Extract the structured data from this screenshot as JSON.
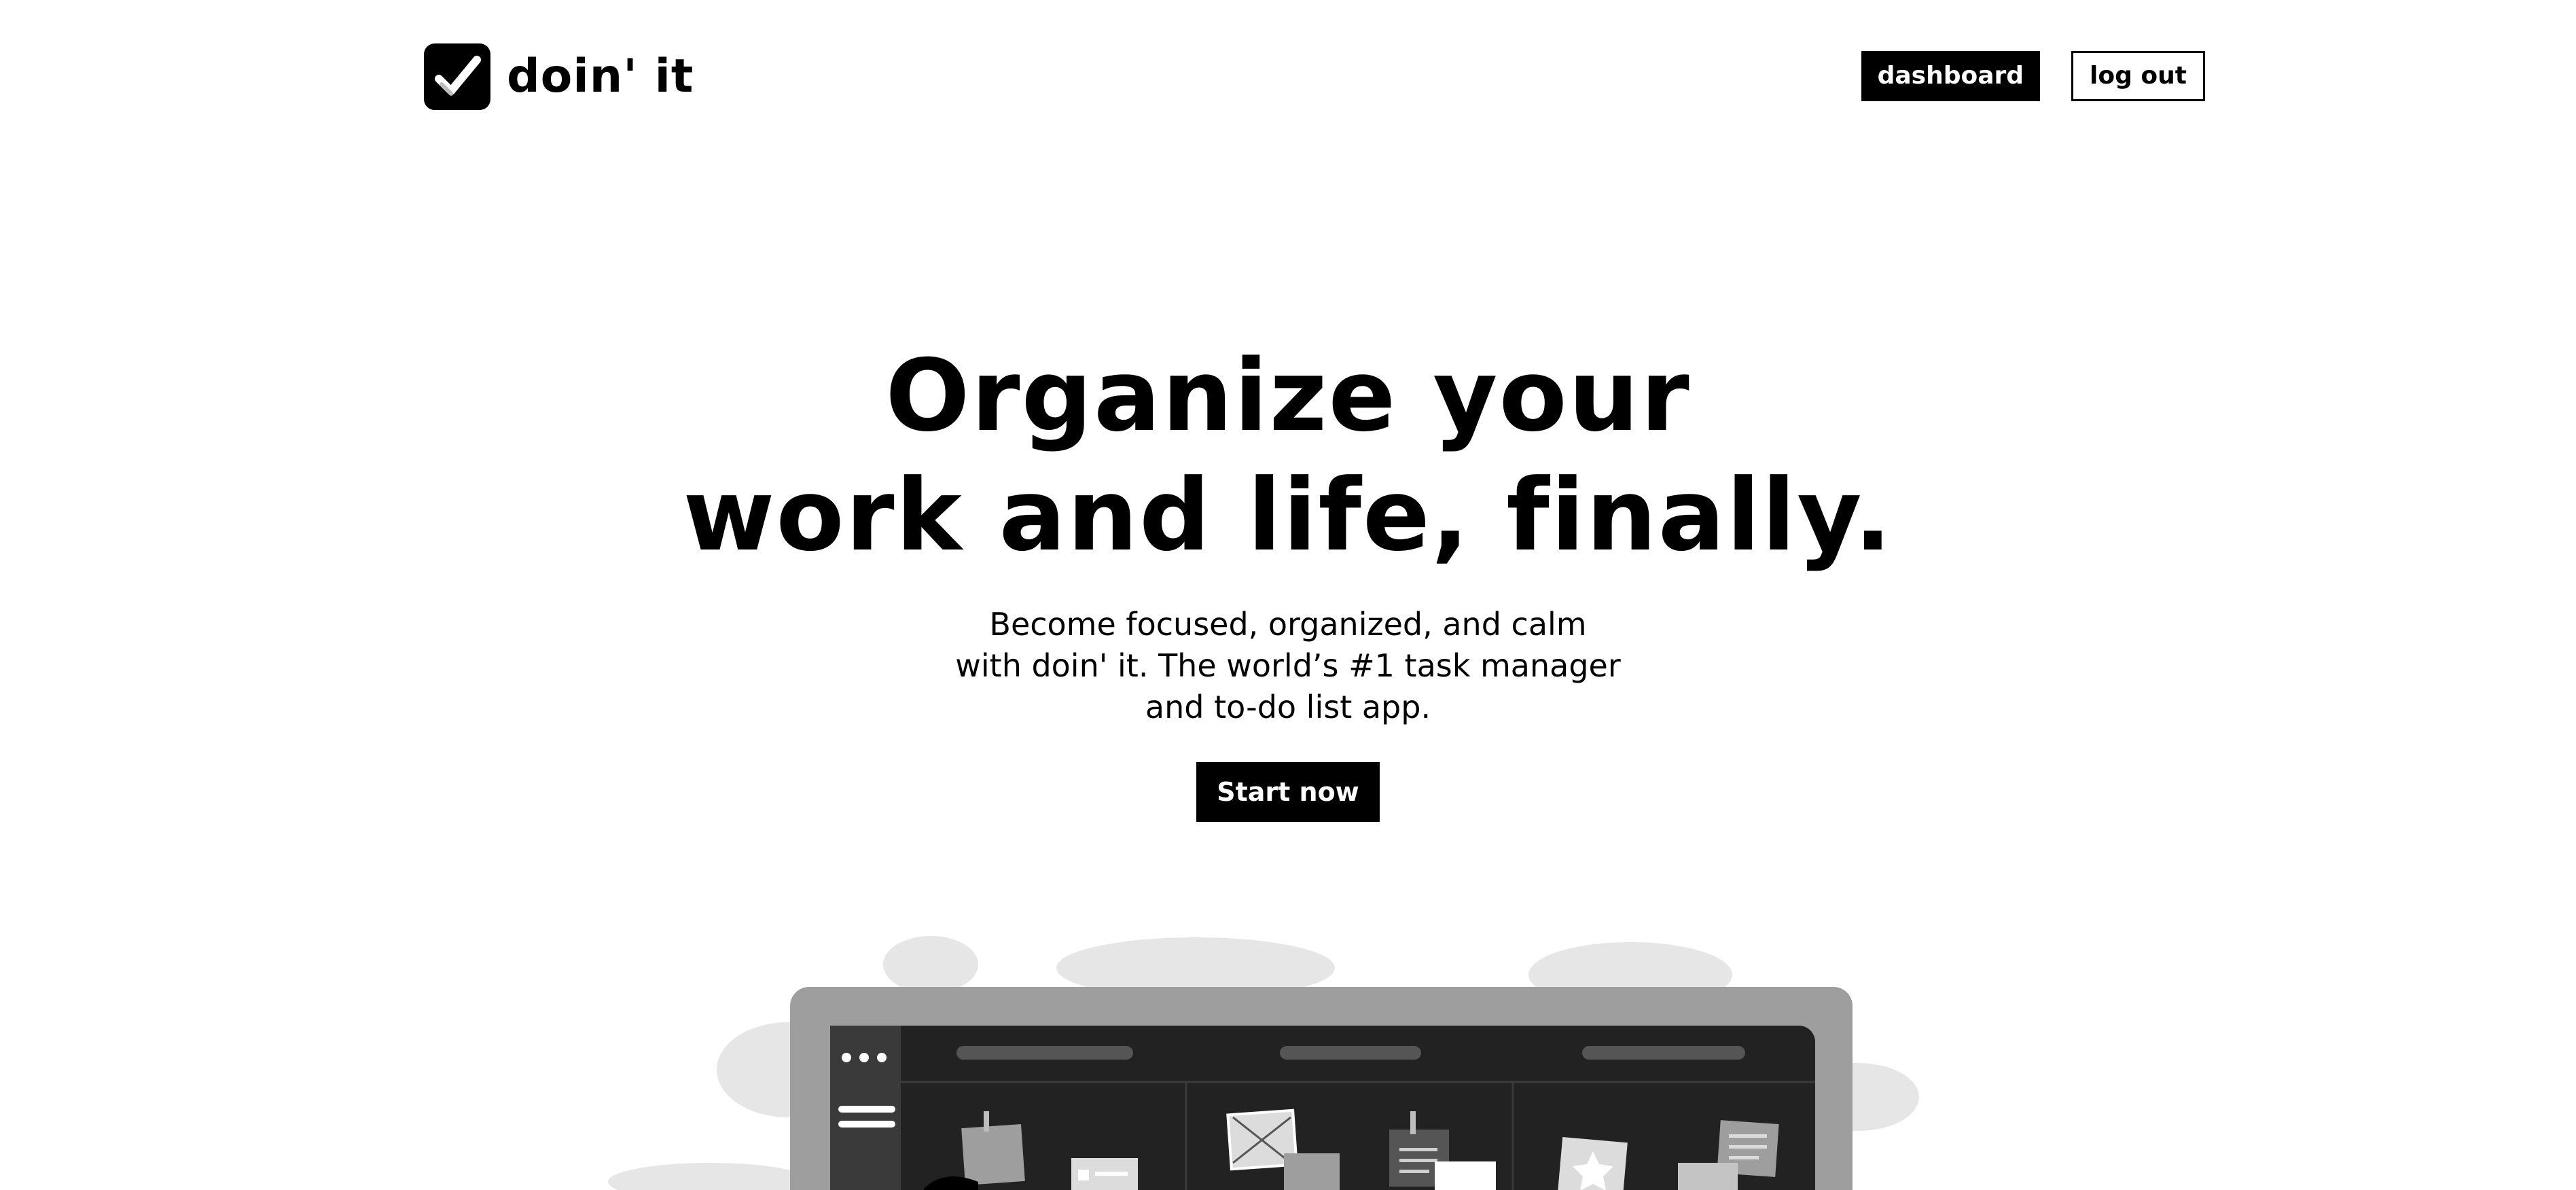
{
  "brand": {
    "name": "doin' it",
    "logo_icon": "checkbox-check-icon"
  },
  "nav": {
    "dashboard_label": "dashboard",
    "logout_label": "log out"
  },
  "hero": {
    "title_line1": "Organize your",
    "title_line2": "work and life, finally.",
    "subtitle": "Become focused, organized, and calm with doin' it. The world’s #1 task manager and to-do list app.",
    "cta_label": "Start now"
  },
  "colors": {
    "primary": "#000000",
    "background": "#ffffff",
    "illustration_gray": "#9e9e9e",
    "board_dark": "#222222"
  }
}
